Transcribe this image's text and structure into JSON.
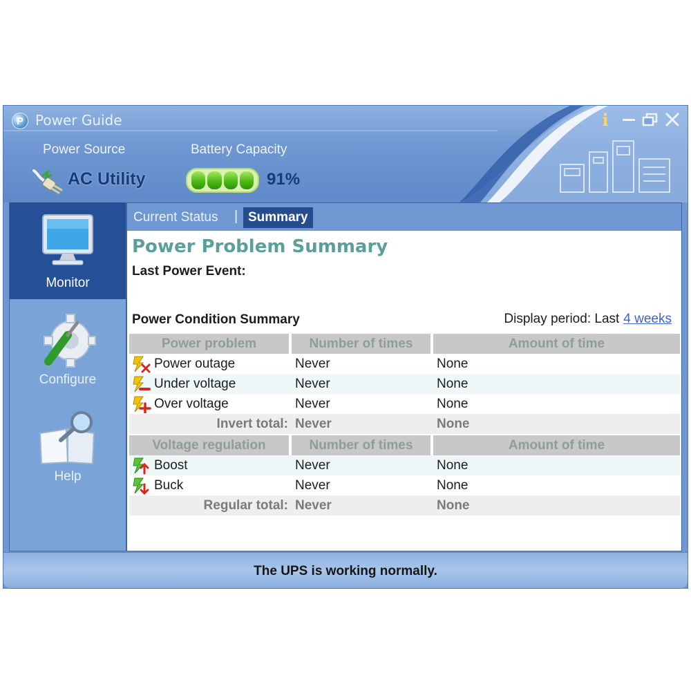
{
  "window": {
    "title": "Power Guide",
    "app_icon_letter": "P",
    "info_glyph": "i"
  },
  "header": {
    "power_source_label": "Power Source",
    "power_source_value": "AC Utility",
    "battery_label": "Battery Capacity",
    "battery_percent": "91%",
    "battery_fill_fraction": 0.91
  },
  "sidebar": {
    "items": [
      {
        "label": "Monitor",
        "icon": "monitor-icon",
        "active": true
      },
      {
        "label": "Configure",
        "icon": "configure-gear-icon",
        "active": false
      },
      {
        "label": "Help",
        "icon": "help-book-icon",
        "active": false
      }
    ]
  },
  "tabs": [
    {
      "label": "Current Status",
      "active": false
    },
    {
      "label": "Summary",
      "active": true
    }
  ],
  "tab_separator": "|",
  "main": {
    "heading": "Power Problem Summary",
    "last_event_label": "Last Power Event:",
    "condition_label": "Power Condition Summary",
    "period_label": "Display period: Last",
    "period_value": "4 weeks"
  },
  "problems_table": {
    "headers": [
      "Power problem",
      "Number of times",
      "Amount of time"
    ],
    "rows": [
      {
        "icon": "power-outage-icon",
        "label": "Power outage",
        "times": "Never",
        "amount": "None"
      },
      {
        "icon": "under-voltage-icon",
        "label": "Under voltage",
        "times": "Never",
        "amount": "None"
      },
      {
        "icon": "over-voltage-icon",
        "label": "Over voltage",
        "times": "Never",
        "amount": "None"
      }
    ],
    "total": {
      "label": "Invert total:",
      "times": "Never",
      "amount": "None"
    }
  },
  "regulation_table": {
    "headers": [
      "Voltage regulation",
      "Number of times",
      "Amount of time"
    ],
    "rows": [
      {
        "icon": "boost-icon",
        "label": "Boost",
        "times": "Never",
        "amount": "None"
      },
      {
        "icon": "buck-icon",
        "label": "Buck",
        "times": "Never",
        "amount": "None"
      }
    ],
    "total": {
      "label": "Regular total:",
      "times": "Never",
      "amount": "None"
    }
  },
  "status_bar": {
    "message": "The UPS is working normally."
  },
  "colors": {
    "frame": "#6f98d3",
    "active_nav": "#254f97",
    "heading": "#5b9f9b",
    "link": "#3f61cf",
    "battery_green": "#49b514"
  }
}
